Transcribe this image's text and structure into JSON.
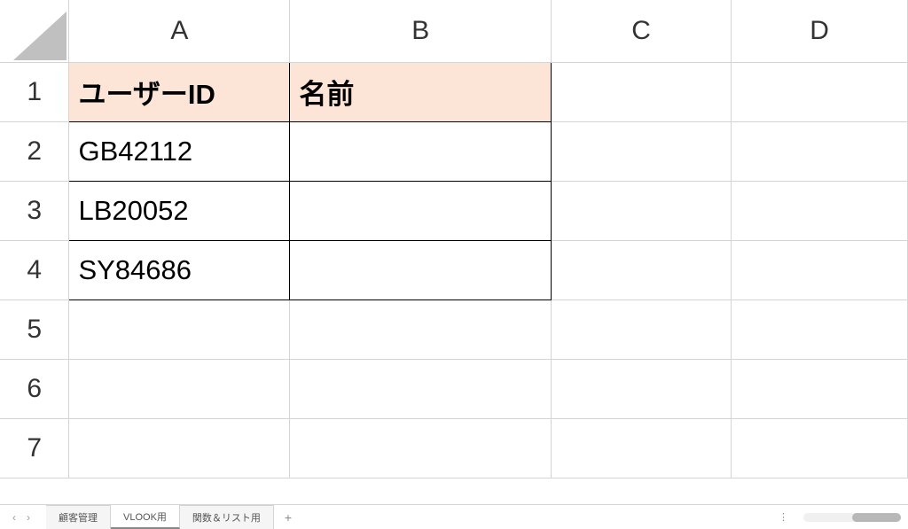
{
  "columns": [
    "A",
    "B",
    "C",
    "D"
  ],
  "rows": [
    "1",
    "2",
    "3",
    "4",
    "5",
    "6",
    "7"
  ],
  "headers": {
    "user_id": "ユーザーID",
    "name": "名前"
  },
  "data": {
    "row2_a": "GB42112",
    "row3_a": "LB20052",
    "row4_a": "SY84686"
  },
  "tabs": {
    "tab1": "顧客管理",
    "tab2": "VLOOK用",
    "tab3": "関数＆リスト用"
  },
  "tab_add": "+",
  "tab_options": "⋮",
  "nav_prev": "‹",
  "nav_next": "›",
  "chart_data": {
    "type": "table",
    "title": "",
    "columns": [
      "ユーザーID",
      "名前"
    ],
    "rows": [
      [
        "GB42112",
        ""
      ],
      [
        "LB20052",
        ""
      ],
      [
        "SY84686",
        ""
      ]
    ]
  }
}
